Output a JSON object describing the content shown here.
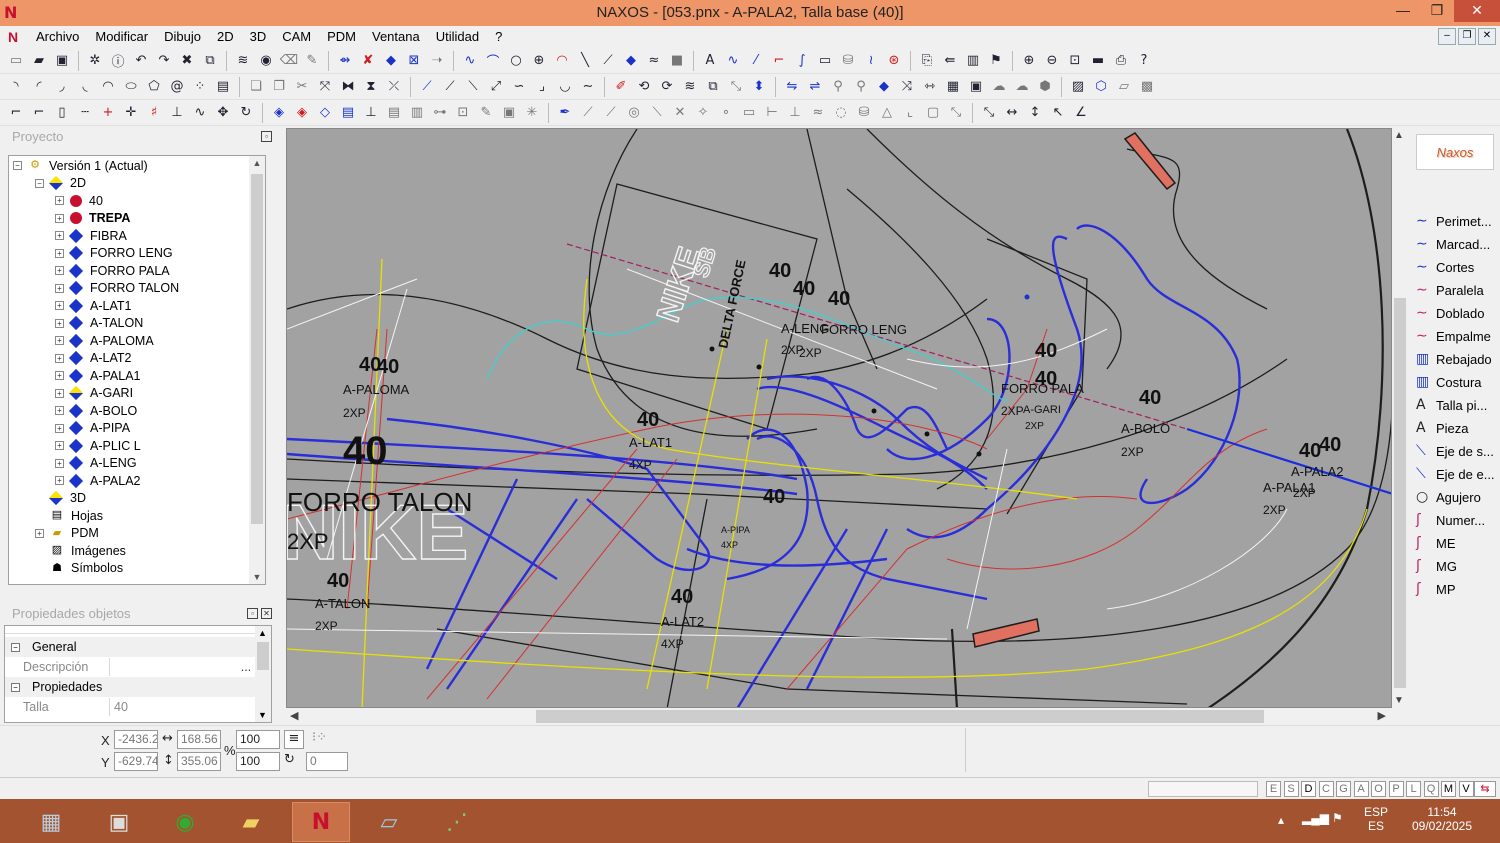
{
  "window": {
    "title": "NAXOS - [053.pnx - A-PALA2, Talla base (40)]",
    "minimize_glyph": "—",
    "maximize_glyph": "❐",
    "close_glyph": "✕"
  },
  "menu": {
    "items": [
      "Archivo",
      "Modificar",
      "Dibujo",
      "2D",
      "3D",
      "CAM",
      "PDM",
      "Ventana",
      "Utilidad",
      "?"
    ]
  },
  "panels": {
    "project_title": "Proyecto",
    "properties_title": "Propiedades objetos"
  },
  "tree": {
    "version": "Versión 1 (Actual)",
    "node_2d": "2D",
    "layers": [
      {
        "label": "40",
        "icon": "red-dot-icon",
        "bold": false
      },
      {
        "label": "TREPA",
        "icon": "red-dot-icon",
        "bold": true
      },
      {
        "label": "FIBRA",
        "icon": "blue-diamond-icon",
        "bold": false
      },
      {
        "label": "FORRO LENG",
        "icon": "blue-diamond-icon",
        "bold": false
      },
      {
        "label": "FORRO PALA",
        "icon": "blue-diamond-icon",
        "bold": false
      },
      {
        "label": "FORRO TALON",
        "icon": "blue-diamond-icon",
        "bold": false
      },
      {
        "label": "A-LAT1",
        "icon": "blue-diamond-icon",
        "bold": false
      },
      {
        "label": "A-TALON",
        "icon": "blue-diamond-icon",
        "bold": false
      },
      {
        "label": "A-PALOMA",
        "icon": "blue-diamond-icon",
        "bold": false
      },
      {
        "label": "A-LAT2",
        "icon": "blue-diamond-icon",
        "bold": false
      },
      {
        "label": "A-PALA1",
        "icon": "blue-diamond-icon",
        "bold": false
      },
      {
        "label": "A-GARI",
        "icon": "mixed-diamond-icon",
        "bold": false
      },
      {
        "label": "A-BOLO",
        "icon": "blue-diamond-icon",
        "bold": false
      },
      {
        "label": "A-PIPA",
        "icon": "blue-diamond-icon",
        "bold": false
      },
      {
        "label": "A-PLIC L",
        "icon": "blue-diamond-icon",
        "bold": false
      },
      {
        "label": "A-LENG",
        "icon": "blue-diamond-icon",
        "bold": false
      },
      {
        "label": "A-PALA2",
        "icon": "blue-diamond-icon",
        "bold": false
      }
    ],
    "node_3d": "3D",
    "node_sheets": "Hojas",
    "node_pdm": "PDM",
    "node_images": "Imágenes",
    "node_symbols": "Símbolos"
  },
  "properties": {
    "general_label": "General",
    "description_label": "Descripción",
    "description_btn": "...",
    "props_label": "Propiedades",
    "size_label": "Talla",
    "size_value": "40"
  },
  "canvas_labels": {
    "size": "40",
    "forro_leng": "FORRO LENG",
    "a_leng": "A-LENG",
    "forro_pala": "FORRO PALA",
    "a_gari": "A-GARI",
    "a_bolo": "A-BOLO",
    "a_pala1": "A-PALA1",
    "a_pala2": "A-PALA2",
    "a_paloma": "A-PALOMA",
    "a_lat1": "A-LAT1",
    "a_lat2": "A-LAT2",
    "a_pipa": "A-PIPA",
    "a_talon": "A-TALON",
    "forro_talon": "FORRO TALON",
    "qty_2xp": "2XP",
    "qty_4xp": "4XP",
    "logo_text": "NIKE",
    "logo_sub": "SB",
    "delta_force": "DELTA FORCE"
  },
  "right_tools": {
    "brand": "Naxos",
    "items": [
      {
        "label": "Perimet...",
        "icon": "perimeter-icon"
      },
      {
        "label": "Marcad...",
        "icon": "marker-icon"
      },
      {
        "label": "Cortes",
        "icon": "cuts-icon"
      },
      {
        "label": "Paralela",
        "icon": "parallel-icon"
      },
      {
        "label": "Doblado",
        "icon": "fold-icon"
      },
      {
        "label": "Empalme",
        "icon": "splice-icon"
      },
      {
        "label": "Rebajado",
        "icon": "skiving-icon"
      },
      {
        "label": "Costura",
        "icon": "seam-icon"
      },
      {
        "label": "Talla pi...",
        "icon": "size-text-icon"
      },
      {
        "label": "Pieza",
        "icon": "piece-text-icon"
      },
      {
        "label": "Eje de s...",
        "icon": "axis-s-icon"
      },
      {
        "label": "Eje de e...",
        "icon": "axis-e-icon"
      },
      {
        "label": "Agujero",
        "icon": "hole-icon"
      },
      {
        "label": "Numer...",
        "icon": "numbering-icon"
      },
      {
        "label": "ME",
        "icon": "me-icon"
      },
      {
        "label": "MG",
        "icon": "mg-icon"
      },
      {
        "label": "MP",
        "icon": "mp-icon"
      }
    ]
  },
  "coords": {
    "x_label": "X",
    "y_label": "Y",
    "x": "-2436.2",
    "y": "-629.74",
    "width": "168.56",
    "height": "355.06",
    "percent_label": "%",
    "scale_x": "100",
    "scale_y": "100",
    "rotation": "0"
  },
  "status": {
    "keys": [
      "E",
      "S",
      "D",
      "C",
      "G",
      "A",
      "O",
      "P",
      "L",
      "Q",
      "M",
      "V"
    ]
  },
  "taskbar": {
    "lang_top": "ESP",
    "lang_bottom": "ES",
    "time": "11:54",
    "date": "09/02/2025"
  }
}
